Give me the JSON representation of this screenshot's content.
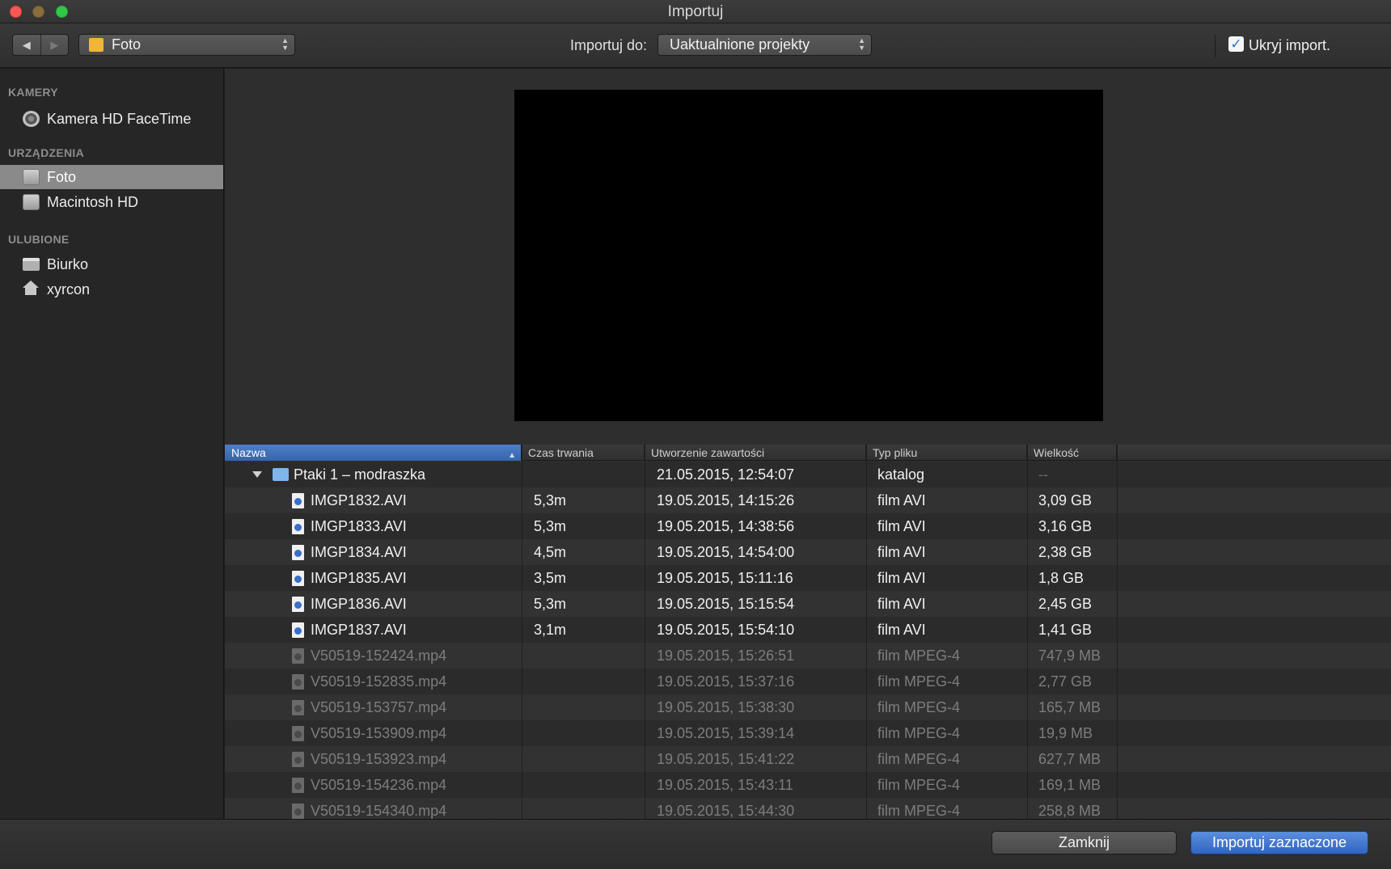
{
  "window": {
    "title": "Importuj"
  },
  "toolbar": {
    "back_label": "◀",
    "forward_label": "▶",
    "source_value": "Foto",
    "import_to_label": "Importuj do:",
    "destination_value": "Uaktualnione projekty",
    "hide_imported_label": "Ukryj import.",
    "hide_imported_checked": true
  },
  "sidebar": {
    "sections": [
      {
        "title": "KAMERY",
        "items": [
          {
            "label": "Kamera HD FaceTime",
            "icon": "camera-icon"
          }
        ]
      },
      {
        "title": "URZĄDZENIA",
        "items": [
          {
            "label": "Foto",
            "icon": "disk-icon",
            "selected": true
          },
          {
            "label": "Macintosh HD",
            "icon": "disk-icon"
          }
        ]
      },
      {
        "title": "ULUBIONE",
        "items": [
          {
            "label": "Biurko",
            "icon": "desktop-icon"
          },
          {
            "label": "xyrcon",
            "icon": "home-icon"
          }
        ]
      }
    ]
  },
  "table": {
    "columns": [
      "Nazwa",
      "Czas trwania",
      "Utworzenie zawartości",
      "Typ pliku",
      "Wielkość"
    ],
    "sorted_column": "Nazwa",
    "folder": {
      "name": "Ptaki 1 – modraszka",
      "duration": "",
      "created": "21.05.2015, 12:54:07",
      "type": "katalog",
      "size": "--"
    },
    "rows": [
      {
        "name": "IMGP1832.AVI",
        "duration": "5,3m",
        "created": "19.05.2015, 14:15:26",
        "type": "film AVI",
        "size": "3,09 GB",
        "dim": false
      },
      {
        "name": "IMGP1833.AVI",
        "duration": "5,3m",
        "created": "19.05.2015, 14:38:56",
        "type": "film AVI",
        "size": "3,16 GB",
        "dim": false
      },
      {
        "name": "IMGP1834.AVI",
        "duration": "4,5m",
        "created": "19.05.2015, 14:54:00",
        "type": "film AVI",
        "size": "2,38 GB",
        "dim": false
      },
      {
        "name": "IMGP1835.AVI",
        "duration": "3,5m",
        "created": "19.05.2015, 15:11:16",
        "type": "film AVI",
        "size": "1,8 GB",
        "dim": false
      },
      {
        "name": "IMGP1836.AVI",
        "duration": "5,3m",
        "created": "19.05.2015, 15:15:54",
        "type": "film AVI",
        "size": "2,45 GB",
        "dim": false
      },
      {
        "name": "IMGP1837.AVI",
        "duration": "3,1m",
        "created": "19.05.2015, 15:54:10",
        "type": "film AVI",
        "size": "1,41 GB",
        "dim": false
      },
      {
        "name": "V50519-152424.mp4",
        "duration": "",
        "created": "19.05.2015, 15:26:51",
        "type": "film MPEG-4",
        "size": "747,9 MB",
        "dim": true
      },
      {
        "name": "V50519-152835.mp4",
        "duration": "",
        "created": "19.05.2015, 15:37:16",
        "type": "film MPEG-4",
        "size": "2,77 GB",
        "dim": true
      },
      {
        "name": "V50519-153757.mp4",
        "duration": "",
        "created": "19.05.2015, 15:38:30",
        "type": "film MPEG-4",
        "size": "165,7 MB",
        "dim": true
      },
      {
        "name": "V50519-153909.mp4",
        "duration": "",
        "created": "19.05.2015, 15:39:14",
        "type": "film MPEG-4",
        "size": "19,9 MB",
        "dim": true
      },
      {
        "name": "V50519-153923.mp4",
        "duration": "",
        "created": "19.05.2015, 15:41:22",
        "type": "film MPEG-4",
        "size": "627,7 MB",
        "dim": true
      },
      {
        "name": "V50519-154236.mp4",
        "duration": "",
        "created": "19.05.2015, 15:43:11",
        "type": "film MPEG-4",
        "size": "169,1 MB",
        "dim": true
      },
      {
        "name": "V50519-154340.mp4",
        "duration": "",
        "created": "19.05.2015, 15:44:30",
        "type": "film MPEG-4",
        "size": "258,8 MB",
        "dim": true
      }
    ]
  },
  "footer": {
    "close_label": "Zamknij",
    "import_label": "Importuj zaznaczone"
  },
  "colors": {
    "accent": "#3564ad",
    "window_bg": "#2e2e2e",
    "sidebar_bg": "#262626",
    "selection": "#8a8a8a"
  }
}
